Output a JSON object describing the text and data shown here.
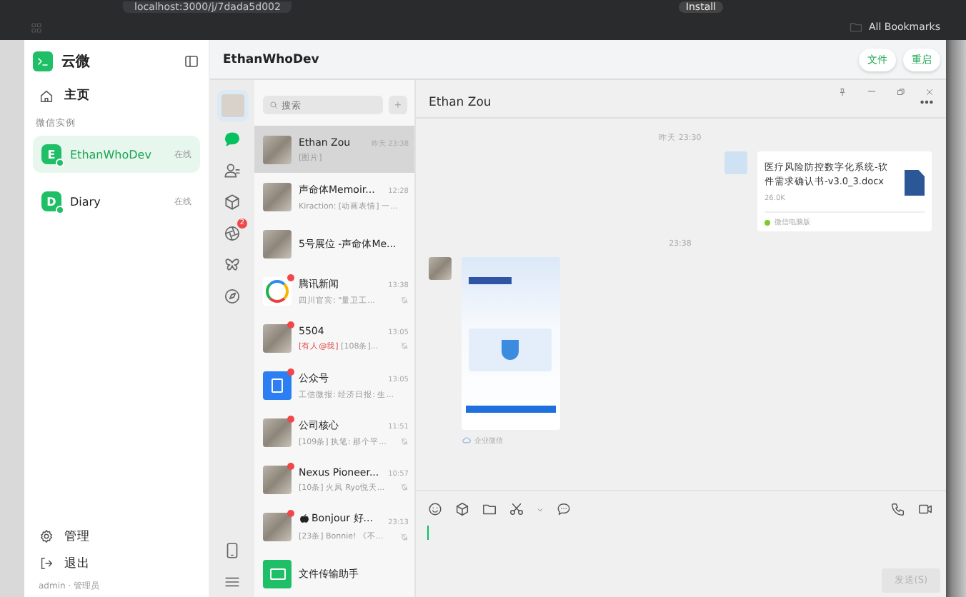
{
  "browser": {
    "url": "localhost:3000/j/7dada5d002",
    "install_label": "Install",
    "bookmarks_label": "All Bookmarks"
  },
  "sidebar": {
    "app_name": "云微",
    "nav": [
      {
        "label": "主页"
      }
    ],
    "section_label": "微信实例",
    "instances": [
      {
        "initial": "E",
        "name": "EthanWhoDev",
        "status": "在线",
        "selected": true
      },
      {
        "initial": "D",
        "name": "Diary",
        "status": "在线",
        "selected": false
      }
    ],
    "footer_items": [
      {
        "label": "管理"
      },
      {
        "label": "退出"
      }
    ],
    "user_line": "admin · 管理员"
  },
  "header": {
    "title": "EthanWhoDev",
    "buttons": [
      "文件",
      "重启"
    ]
  },
  "rail": {
    "items": [
      {
        "selected": false
      },
      {
        "selected": true
      },
      {
        "selected": false
      },
      {
        "selected": false
      },
      {
        "selected": false,
        "badge": "2"
      },
      {
        "selected": false
      },
      {
        "selected": false
      }
    ]
  },
  "chat_list": {
    "search_placeholder": "搜索",
    "add_label": "+",
    "chats": [
      {
        "name": "Ethan Zou",
        "time": "昨天 23:38",
        "preview": "[图片]",
        "kind": "photo",
        "selected": true,
        "unread": false,
        "muted": false
      },
      {
        "name": "声命体Memoir...",
        "time": "12:28",
        "preview": "Kiraction: [动画表情] 一...",
        "kind": "photo",
        "selected": false,
        "unread": false,
        "muted": false
      },
      {
        "name": "5号展位 -声命体Me...",
        "kind": "photo",
        "selected": false,
        "unread": false
      },
      {
        "name": "腾讯新闻",
        "time": "13:38",
        "preview": "四川官宾: \"量卫工...",
        "kind": "news",
        "selected": false,
        "unread": true,
        "muted": true
      },
      {
        "name": "5504",
        "time": "13:05",
        "mention": "[有人@我]",
        "preview": "[108条]...",
        "kind": "photo",
        "selected": false,
        "unread": true,
        "muted": true
      },
      {
        "name": "公众号",
        "time": "13:05",
        "preview": "工信微报: 经济日报: 生...",
        "kind": "logo",
        "selected": false,
        "unread": true,
        "muted": false
      },
      {
        "name": "公司核心",
        "time": "11:51",
        "preview": "[109条] 执笔: 那个平...",
        "kind": "photo",
        "selected": false,
        "unread": true,
        "muted": true
      },
      {
        "name": "Nexus Pioneer...",
        "time": "10:57",
        "preview": "[10条] 火凤 Ryo悦天...",
        "kind": "photo",
        "selected": false,
        "unread": true,
        "muted": true
      },
      {
        "name": "Bonjour 好...",
        "time": "23:13",
        "preview": "[23条] Bonnie! 《不...",
        "kind": "photo",
        "selected": false,
        "unread": true,
        "muted": true
      },
      {
        "name": "文件传输助手",
        "kind": "folder",
        "selected": false,
        "unread": false
      }
    ]
  },
  "conversation": {
    "title": "Ethan Zou",
    "messages": [
      {
        "kind": "time",
        "text": "昨天 23:30"
      },
      {
        "kind": "file",
        "outgoing": true,
        "file_name": "医疗风险防控数字化系统-软件需求确认书-v3.0_3.docx",
        "size": "26.0K",
        "source": "微信电脑版"
      },
      {
        "kind": "time",
        "text": "23:38"
      },
      {
        "kind": "image",
        "outgoing": false,
        "source": "企业微信"
      }
    ],
    "send_label": "发送(S)",
    "send_disabled": true
  }
}
